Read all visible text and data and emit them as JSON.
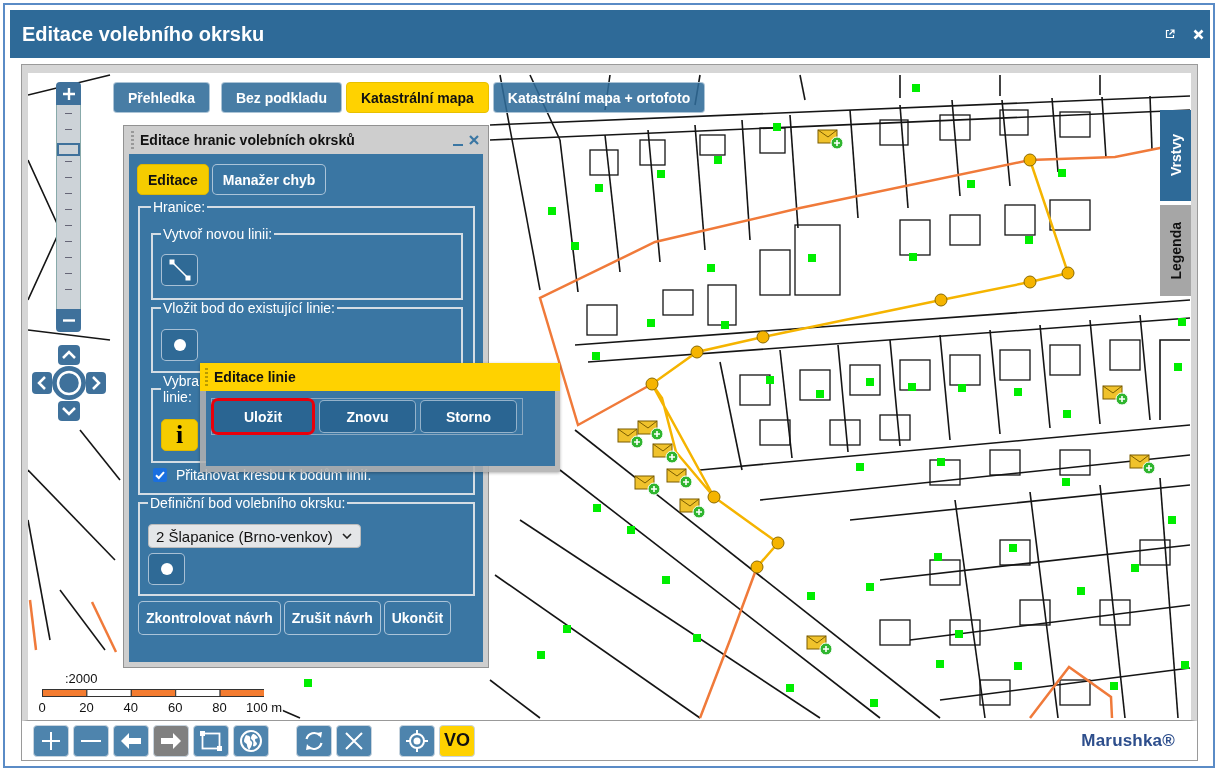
{
  "window": {
    "title": "Editace volebního okrsku"
  },
  "map": {
    "base_layers": [
      {
        "label": "Přehledka",
        "selected": false
      },
      {
        "label": "Bez podkladu",
        "selected": false
      },
      {
        "label": "Katastrální mapa",
        "selected": true
      },
      {
        "label": "Katastrální mapa + ortofoto",
        "selected": false
      }
    ],
    "zoom": {
      "level": 0.8
    },
    "side_tabs": [
      {
        "label": "Vrstvy",
        "selected": true
      },
      {
        "label": "Legenda",
        "selected": false
      }
    ],
    "scale": {
      "ratio": ":2000",
      "labels": [
        "0",
        "20",
        "40",
        "60",
        "80",
        "100 m"
      ]
    }
  },
  "panel": {
    "title": "Editace hranic volebních okrsků",
    "tabs": [
      {
        "label": "Editace",
        "selected": true
      },
      {
        "label": "Manažer chyb",
        "selected": false
      }
    ],
    "boundaries": {
      "legend": "Hranice:",
      "groups": [
        {
          "kind": "line",
          "legend": "Vytvoř novou linii:"
        },
        {
          "kind": "point",
          "legend": "Vložit bod do existující linie:"
        },
        {
          "kind": "info",
          "legend": "Vybra",
          "legend_end": "linie:",
          "button_text": "i"
        }
      ],
      "snap": {
        "label": "Přitahovat kresbu k bodům linií.",
        "checked": true
      }
    },
    "definition_point": {
      "legend": "Definiční bod volebního okrsku:",
      "value": "2 Šlapanice (Brno-venkov)"
    },
    "buttons": [
      "Zkontrolovat návrh",
      "Zrušit návrh",
      "Ukončit"
    ]
  },
  "line_popup": {
    "title": "Editace linie",
    "buttons": [
      {
        "label": "Uložit",
        "highlighted": true
      },
      {
        "label": "Znovu",
        "highlighted": false
      },
      {
        "label": "Storno",
        "highlighted": false
      }
    ]
  },
  "toolbar": {
    "groups": [
      {
        "buttons": [
          {
            "kind": "icon",
            "disabled": false
          },
          {
            "kind": "icon",
            "disabled": false
          },
          {
            "kind": "icon",
            "disabled": false
          },
          {
            "kind": "icon",
            "disabled": true
          },
          {
            "kind": "icon",
            "disabled": false
          },
          {
            "kind": "icon",
            "disabled": false
          }
        ]
      },
      {
        "buttons": [
          {
            "kind": "icon",
            "disabled": false
          },
          {
            "kind": "icon",
            "disabled": false
          }
        ]
      },
      {
        "buttons": [
          {
            "kind": "icon",
            "disabled": false
          },
          {
            "kind": "text",
            "label": "VO",
            "on": true
          }
        ]
      }
    ],
    "brand": "Marushka®"
  }
}
